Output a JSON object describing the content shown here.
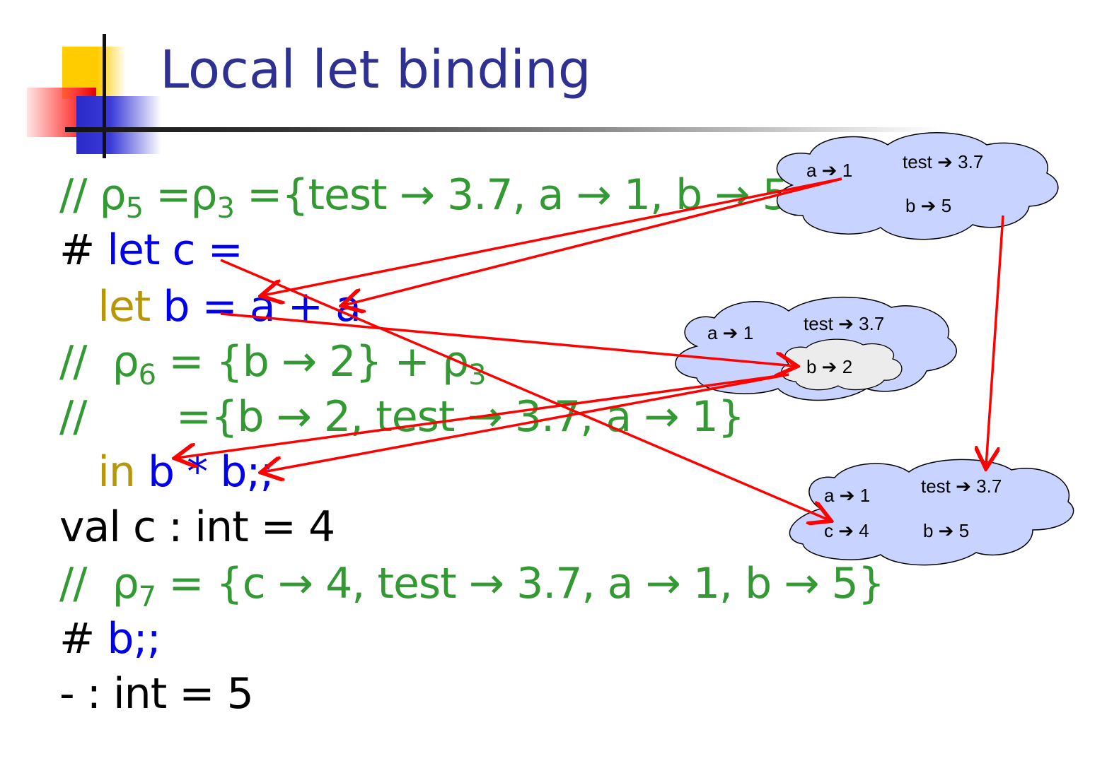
{
  "title": "Local let binding",
  "lines": {
    "l1": {
      "comment": "// ρ",
      "sub1": "5",
      "eq1": " =ρ",
      "sub2": "3",
      "rest": " ={test → 3.7, a → 1, b → 5}"
    },
    "l2": {
      "prompt": "# ",
      "code": "let c ="
    },
    "l3": {
      "indent": "   ",
      "kw": "let",
      "code": " b = a + a"
    },
    "l4": {
      "comment": "//  ρ",
      "sub1": "6",
      "mid": " = {b → 2} + ρ",
      "sub2": "3"
    },
    "l5": {
      "comment": "//       ={b → 2, test → 3.7, a → 1}"
    },
    "l6": {
      "indent": "   ",
      "kw": "in",
      "code": " b * b;;"
    },
    "l7": {
      "text": "val c : int = 4"
    },
    "l8": {
      "comment": "//  ρ",
      "sub1": "7",
      "rest": " = {c → 4, test → 3.7, a → 1, b → 5}"
    },
    "l9": {
      "prompt": "# ",
      "code": "b;;"
    },
    "l10": {
      "text": "- : int = 5"
    }
  },
  "clouds": {
    "env1": {
      "a": "a ➔ 1",
      "test": "test ➔ 3.7",
      "b": "b ➔ 5"
    },
    "env2": {
      "a": "a ➔ 1",
      "test": "test ➔ 3.7",
      "b": "b ➔ 2"
    },
    "env3": {
      "a": "a ➔ 1",
      "test": "test ➔ 3.7",
      "c": "c ➔ 4",
      "b": "b ➔ 5"
    }
  },
  "colors": {
    "title": "#2e3192",
    "comment": "#339933",
    "keyword": "#0000ee",
    "let_in": "#b8960c",
    "arrow": "#ff0000",
    "cloud": "#c9d3ff",
    "inner_cloud": "#ececec"
  }
}
